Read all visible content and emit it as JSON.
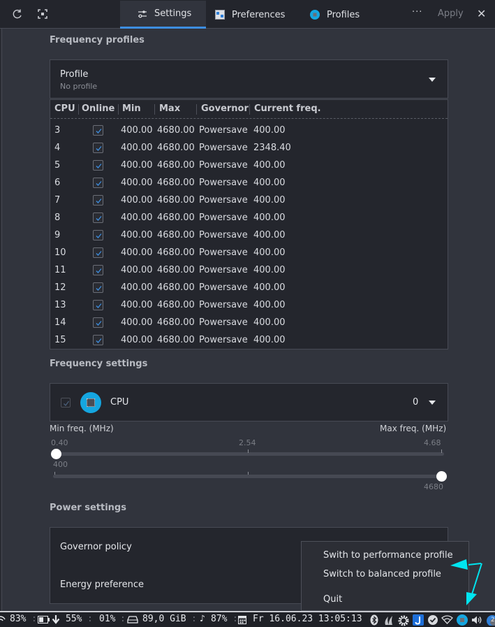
{
  "toolbar": {
    "refresh_icon": "refresh-icon",
    "fullscreen_icon": "fit-screen-icon",
    "tabs": [
      {
        "label": "Settings",
        "icon": "sliders-icon",
        "active": true
      },
      {
        "label": "Preferences",
        "icon": "preferences-icon",
        "active": false
      },
      {
        "label": "Profiles",
        "icon": "cpu-chip-icon",
        "active": false
      }
    ],
    "more_label": "···",
    "apply_label": "Apply",
    "close_label": "✕"
  },
  "frequency_profiles": {
    "title": "Frequency profiles",
    "profile_combo": {
      "label": "Profile",
      "value": "No profile"
    },
    "table": {
      "columns": [
        "CPU",
        "Online",
        "Min",
        "Max",
        "Governor",
        "Current freq."
      ],
      "rows": [
        {
          "cpu": "3",
          "online": true,
          "min": "400.00",
          "max": "4680.00",
          "governor": "Powersave",
          "current": "400.00"
        },
        {
          "cpu": "4",
          "online": true,
          "min": "400.00",
          "max": "4680.00",
          "governor": "Powersave",
          "current": "2348.40"
        },
        {
          "cpu": "5",
          "online": true,
          "min": "400.00",
          "max": "4680.00",
          "governor": "Powersave",
          "current": "400.00"
        },
        {
          "cpu": "6",
          "online": true,
          "min": "400.00",
          "max": "4680.00",
          "governor": "Powersave",
          "current": "400.00"
        },
        {
          "cpu": "7",
          "online": true,
          "min": "400.00",
          "max": "4680.00",
          "governor": "Powersave",
          "current": "400.00"
        },
        {
          "cpu": "8",
          "online": true,
          "min": "400.00",
          "max": "4680.00",
          "governor": "Powersave",
          "current": "400.00"
        },
        {
          "cpu": "9",
          "online": true,
          "min": "400.00",
          "max": "4680.00",
          "governor": "Powersave",
          "current": "400.00"
        },
        {
          "cpu": "10",
          "online": true,
          "min": "400.00",
          "max": "4680.00",
          "governor": "Powersave",
          "current": "400.00"
        },
        {
          "cpu": "11",
          "online": true,
          "min": "400.00",
          "max": "4680.00",
          "governor": "Powersave",
          "current": "400.00"
        },
        {
          "cpu": "12",
          "online": true,
          "min": "400.00",
          "max": "4680.00",
          "governor": "Powersave",
          "current": "400.00"
        },
        {
          "cpu": "13",
          "online": true,
          "min": "400.00",
          "max": "4680.00",
          "governor": "Powersave",
          "current": "400.00"
        },
        {
          "cpu": "14",
          "online": true,
          "min": "400.00",
          "max": "4680.00",
          "governor": "Powersave",
          "current": "400.00"
        },
        {
          "cpu": "15",
          "online": true,
          "min": "400.00",
          "max": "4680.00",
          "governor": "Powersave",
          "current": "400.00"
        }
      ]
    }
  },
  "frequency_settings": {
    "title": "Frequency settings",
    "cpu_selector": {
      "checked": true,
      "label": "CPU",
      "value": "0"
    },
    "min_label": "Min freq. (MHz)",
    "max_label": "Max freq. (MHz)",
    "scale_ticks": [
      "0.40",
      "2.54",
      "4.68"
    ],
    "min_slider": {
      "value": 400,
      "value_label": "400",
      "range": [
        400,
        4680
      ]
    },
    "max_slider": {
      "value": 4680,
      "value_label": "4680",
      "range": [
        400,
        4680
      ]
    }
  },
  "power_settings": {
    "title": "Power settings",
    "governor_label": "Governor policy",
    "energy_label": "Energy preference"
  },
  "context_menu": {
    "items": [
      "Swith to performance profile",
      "Switch to balanced profile",
      "Quit"
    ]
  },
  "annotation": {
    "color": "#00e5f0"
  },
  "panel": {
    "wifi": "83%",
    "battery": "55%",
    "cpu": "01%",
    "disk": "89,0 GiB",
    "volume": "87%",
    "datetime": "Fr 16.06.23 13:05:13",
    "tray_icons": [
      "bluetooth-icon",
      "flame-icon",
      "gear-logo-icon",
      "app-j-icon",
      "check-circle-icon",
      "wifi-icon",
      "cpu-chip-icon",
      "volume-icon",
      "updates-icon"
    ],
    "updates_badge": "2"
  }
}
